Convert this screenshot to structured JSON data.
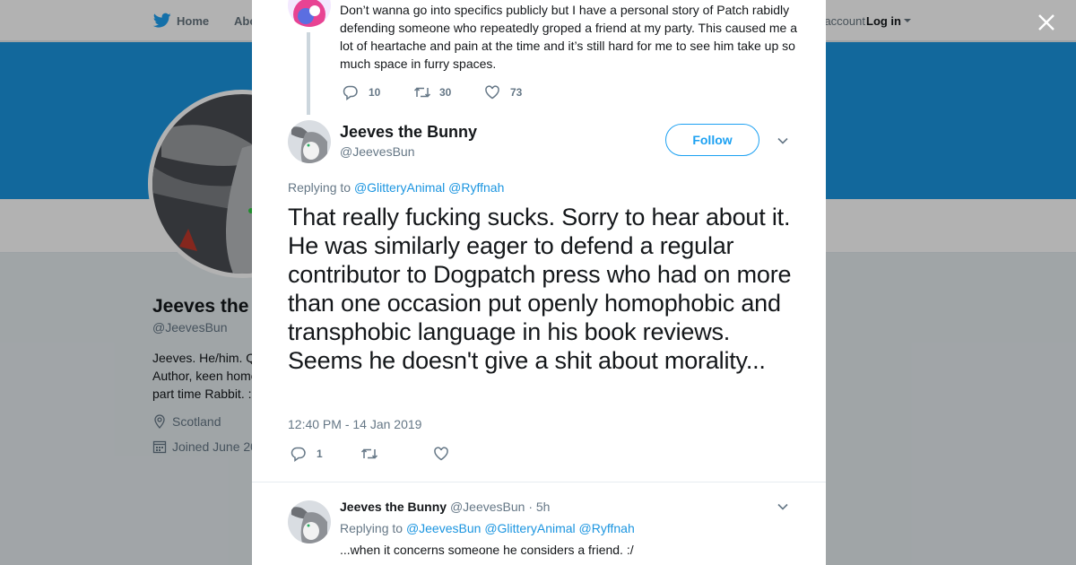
{
  "nav": {
    "home_label": "Home",
    "about_label": "Abo",
    "have_account": "Have an account?",
    "login_label": "Log in"
  },
  "profile": {
    "name": "Jeeves the",
    "handle": "@JeevesBun",
    "bio": "Jeeves. He/him. Q Author, keen home part time Rabbit. :",
    "location": "Scotland",
    "joined": "Joined June 20"
  },
  "modal": {
    "previous_tweet": {
      "text": "Don’t wanna go into specifics publicly but I have a personal story of Patch rabidly defending someone who repeatedly groped a friend at my party. This caused me a lot of heartache and pain at the time and it’s still hard for me to see him take up so much space in furry spaces.",
      "replies": "10",
      "retweets": "30",
      "likes": "73"
    },
    "main_tweet": {
      "name": "Jeeves the Bunny",
      "handle": "@JeevesBun",
      "follow_label": "Follow",
      "replying_prefix": "Replying to",
      "replying_to_1": "@GlitteryAnimal",
      "replying_to_2": "@Ryffnah",
      "text": "That really fucking sucks. Sorry to hear about it. He was similarly eager to defend a regular contributor to Dogpatch press who had on more than one occasion put openly homophobic and transphobic language in his book reviews. Seems he doesn't give a shit about morality...",
      "timestamp": "12:40 PM - 14 Jan 2019",
      "replies": "1"
    },
    "reply_tweet": {
      "name": "Jeeves the Bunny",
      "handle": "@JeevesBun",
      "age": "· 5h",
      "replying_prefix": "Replying to",
      "replying_to_1": "@JeevesBun",
      "replying_to_2": "@GlitteryAnimal",
      "replying_to_3": "@Ryffnah",
      "text": "...when it concerns someone he considers a friend. :/"
    }
  },
  "colors": {
    "brand_blue": "#1da1f2",
    "link_blue": "#1b95e0",
    "banner_blue": "#1b95e0",
    "muted_text": "#657786"
  },
  "icons": [
    "twitter-bird-icon",
    "close-icon",
    "reply-icon",
    "retweet-icon",
    "like-icon",
    "chevron-down-icon",
    "location-icon",
    "calendar-icon"
  ]
}
